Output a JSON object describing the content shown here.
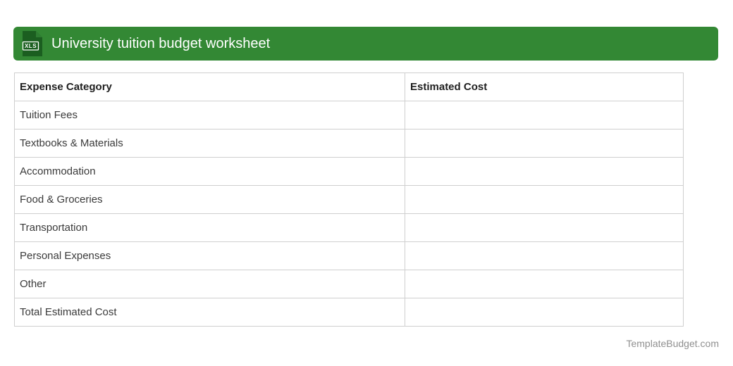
{
  "header": {
    "title": "University tuition budget worksheet",
    "icon_label": "XLS",
    "colors": {
      "bar_bg": "#338834",
      "icon_body": "#1b5e20",
      "icon_fold": "#2e7d32",
      "title_text": "#ffffff"
    }
  },
  "table": {
    "columns": [
      {
        "label": "Expense Category"
      },
      {
        "label": "Estimated Cost"
      }
    ],
    "rows": [
      {
        "category": "Tuition Fees",
        "cost": ""
      },
      {
        "category": "Textbooks & Materials",
        "cost": ""
      },
      {
        "category": "Accommodation",
        "cost": ""
      },
      {
        "category": "Food & Groceries",
        "cost": ""
      },
      {
        "category": "Transportation",
        "cost": ""
      },
      {
        "category": "Personal Expenses",
        "cost": ""
      },
      {
        "category": "Other",
        "cost": ""
      },
      {
        "category": "Total Estimated Cost",
        "cost": ""
      }
    ],
    "colors": {
      "border": "#cfcfcf",
      "header_text": "#1f1f1f",
      "cell_text": "#3a3a3a"
    }
  },
  "footer": {
    "site_name": "TemplateBudget.com",
    "color": "#8f8f8f"
  }
}
